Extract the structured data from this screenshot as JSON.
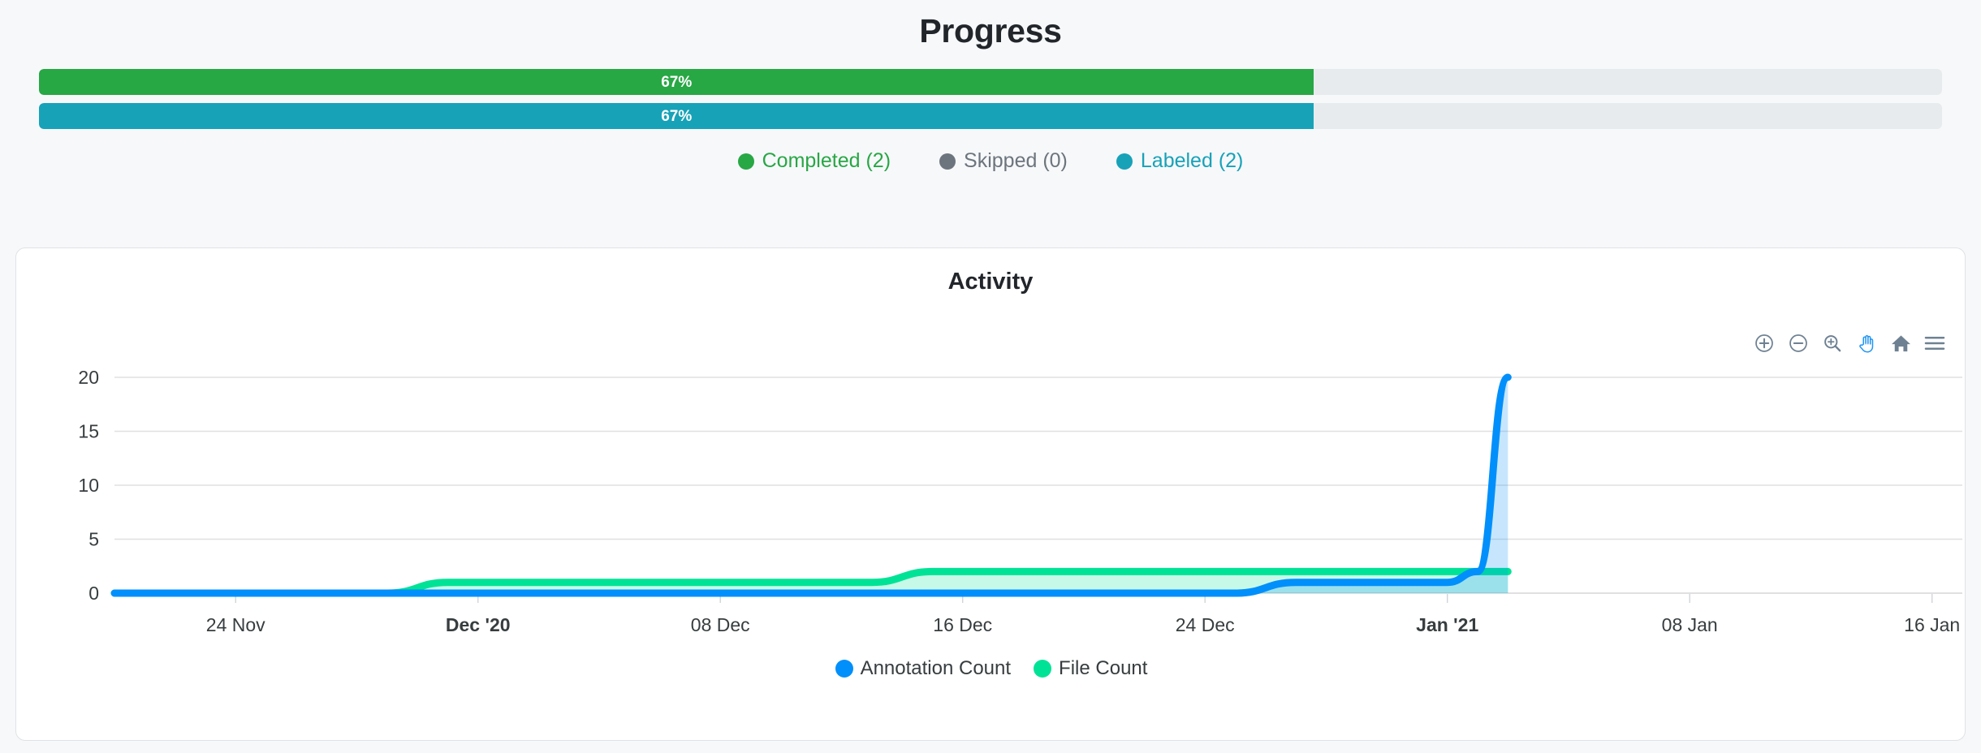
{
  "header": {
    "title": "Progress"
  },
  "progress_bars": [
    {
      "name": "completed",
      "label": "67%",
      "percent": 67,
      "color": "#28a745"
    },
    {
      "name": "labeled",
      "label": "67%",
      "percent": 67,
      "color": "#17a2b8"
    }
  ],
  "status_legend": [
    {
      "label": "Completed (2)",
      "color": "#28a745"
    },
    {
      "label": "Skipped (0)",
      "color": "#6c757d"
    },
    {
      "label": "Labeled (2)",
      "color": "#17a2b8"
    }
  ],
  "activity_card": {
    "title": "Activity",
    "toolbar": [
      {
        "icon": "zoom-in-icon",
        "label": "Zoom In",
        "active": false
      },
      {
        "icon": "zoom-out-icon",
        "label": "Zoom Out",
        "active": false
      },
      {
        "icon": "selection-zoom-icon",
        "label": "Selection Zoom",
        "active": false
      },
      {
        "icon": "pan-icon",
        "label": "Panning",
        "active": true
      },
      {
        "icon": "home-icon",
        "label": "Reset Zoom",
        "active": false
      },
      {
        "icon": "menu-icon",
        "label": "Menu",
        "active": false
      }
    ]
  },
  "chart_data": {
    "type": "area",
    "title": "Activity",
    "xlabel": "",
    "ylabel": "",
    "ylim": [
      0,
      20
    ],
    "yticks": [
      0,
      5,
      10,
      15,
      20
    ],
    "ytick_labels": [
      "0",
      "5",
      "10",
      "15",
      "20"
    ],
    "grid": true,
    "legend_position": "bottom",
    "xtick_labels": [
      "24 Nov",
      "Dec '20",
      "08 Dec",
      "16 Dec",
      "24 Dec",
      "Jan '21",
      "08 Jan",
      "16 Jan"
    ],
    "xtick_bold": [
      false,
      true,
      false,
      false,
      false,
      true,
      false,
      false
    ],
    "xaxis_range": [
      "2020-11-20",
      "2021-01-20"
    ],
    "series": [
      {
        "name": "Annotation Count",
        "color": "#008FFB",
        "points": [
          {
            "x": "2020-11-20",
            "y": 0
          },
          {
            "x": "2020-12-27",
            "y": 0
          },
          {
            "x": "2020-12-29",
            "y": 1
          },
          {
            "x": "2021-01-03",
            "y": 1
          },
          {
            "x": "2021-01-04",
            "y": 2
          },
          {
            "x": "2021-01-05",
            "y": 20
          }
        ]
      },
      {
        "name": "File Count",
        "color": "#00E396",
        "points": [
          {
            "x": "2020-11-20",
            "y": 0
          },
          {
            "x": "2020-11-29",
            "y": 0
          },
          {
            "x": "2020-12-01",
            "y": 1
          },
          {
            "x": "2020-12-15",
            "y": 1
          },
          {
            "x": "2020-12-17",
            "y": 2
          },
          {
            "x": "2021-01-05",
            "y": 2
          }
        ]
      }
    ]
  }
}
